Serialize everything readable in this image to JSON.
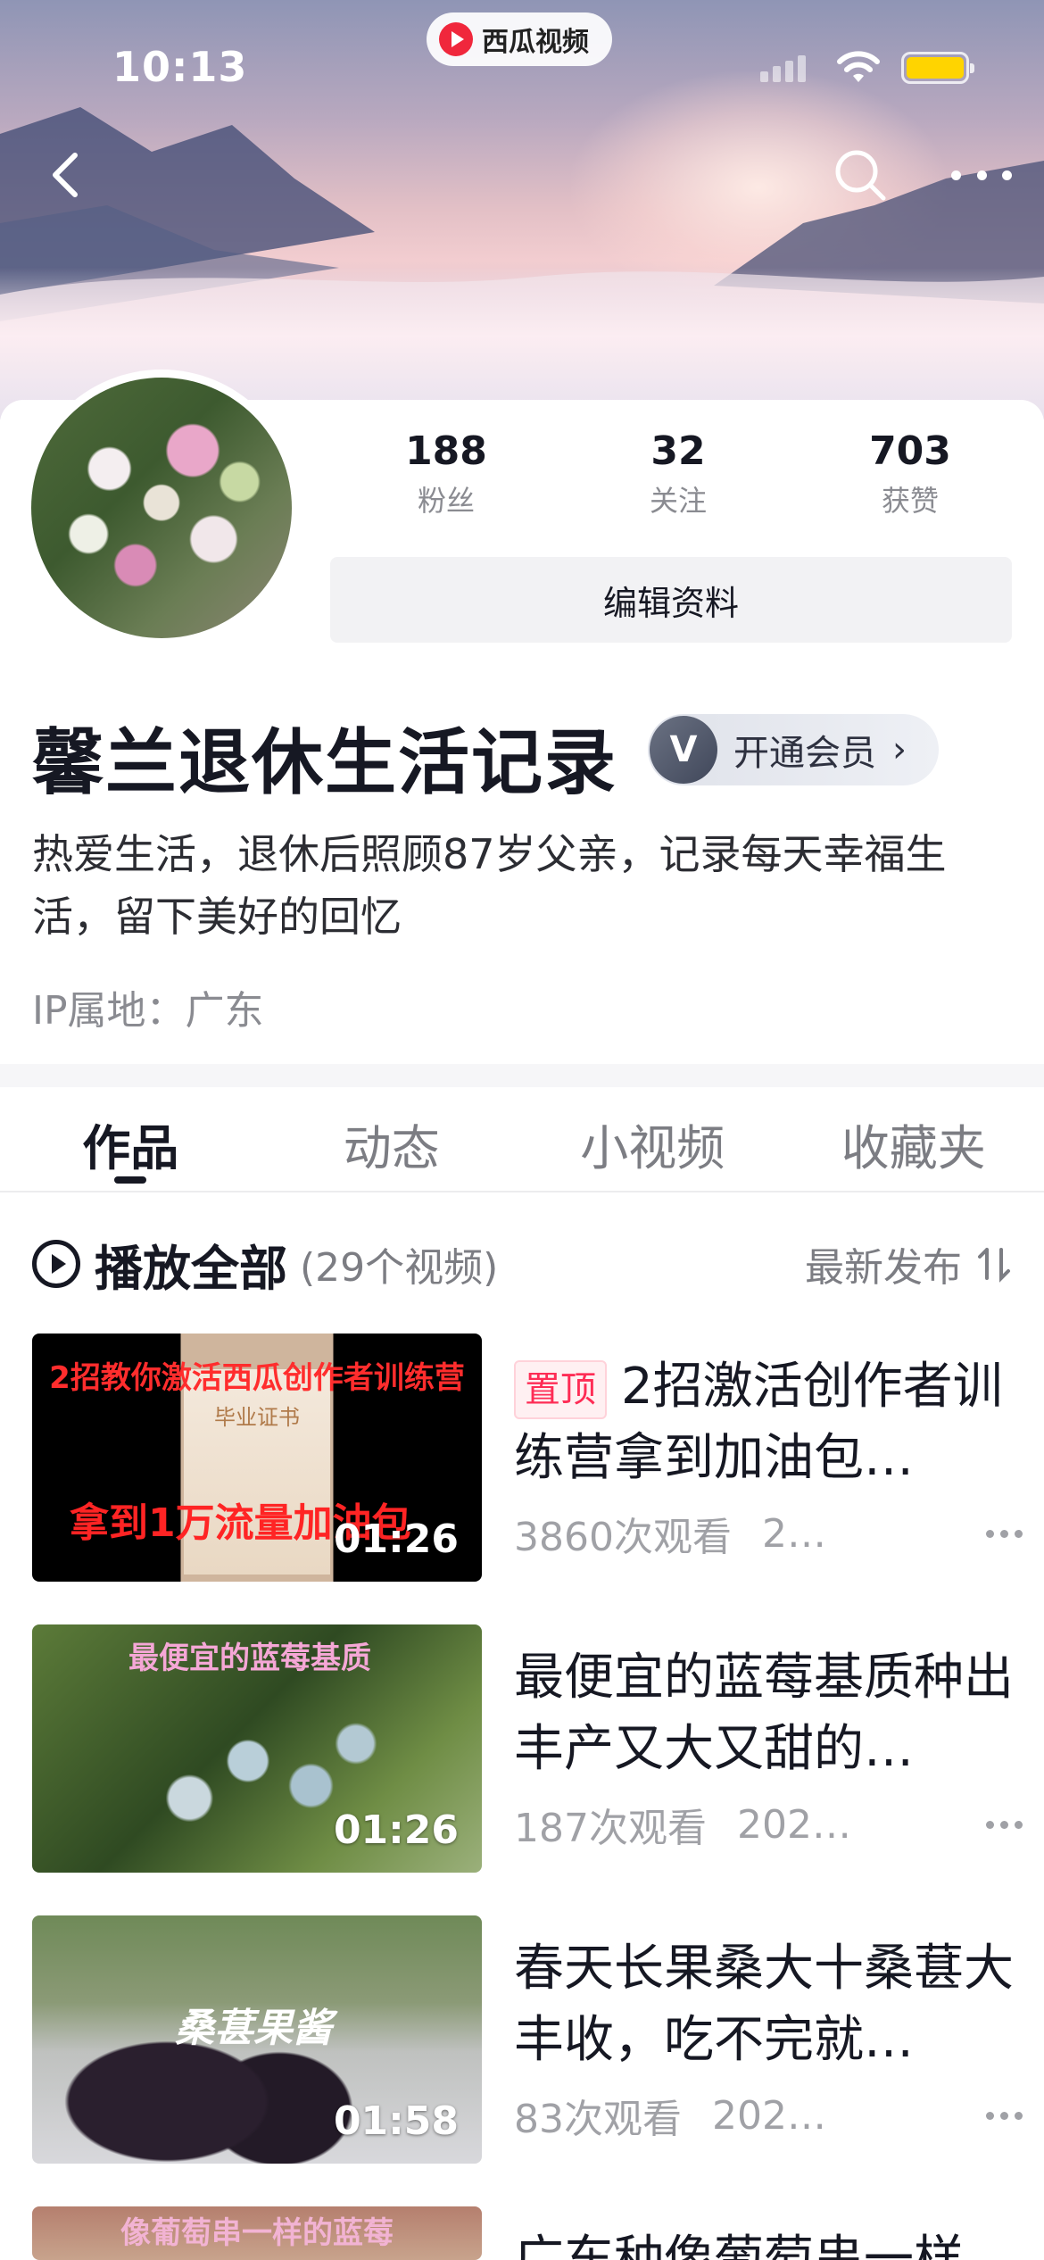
{
  "status_bar": {
    "time": "10:13",
    "app_name": "西瓜视频",
    "battery_color": "#ffd400"
  },
  "nav": {
    "back_icon": "chevron-left-icon",
    "search_icon": "search-icon",
    "more_icon": "more-dots-icon"
  },
  "stats": [
    {
      "value": "188",
      "label": "粉丝"
    },
    {
      "value": "32",
      "label": "关注"
    },
    {
      "value": "703",
      "label": "获赞"
    }
  ],
  "profile": {
    "edit_button": "编辑资料",
    "username": "馨兰退休生活记录",
    "vip_icon_text": "V",
    "vip_label": "开通会员",
    "bio": "热爱生活，退休后照顾87岁父亲，记录每天幸福生活，留下美好的回忆",
    "ip_location": "IP属地：广东"
  },
  "tabs": [
    {
      "label": "作品",
      "active": true
    },
    {
      "label": "动态",
      "active": false
    },
    {
      "label": "小视频",
      "active": false
    },
    {
      "label": "收藏夹",
      "active": false
    }
  ],
  "list_header": {
    "play_all": "播放全部",
    "count": "(29个视频)",
    "sort": "最新发布"
  },
  "videos": [
    {
      "pinned_label": "置顶",
      "title": "2招激活创作者训练营拿到加油包…",
      "views": "3860次观看",
      "date": "2…",
      "duration": "01:26",
      "thumb_caption_top": "2招教你激活西瓜创作者训练营",
      "thumb_caption_mid": "毕业证书",
      "thumb_caption_bottom": "拿到1万流量加油包"
    },
    {
      "title": "最便宜的蓝莓基质种出丰产又大又甜的…",
      "views": "187次观看",
      "date": "202…",
      "duration": "01:26",
      "thumb_caption_top": "最便宜的蓝莓基质"
    },
    {
      "title": "春天长果桑大十桑葚大丰收，吃不完就…",
      "views": "83次观看",
      "date": "202…",
      "duration": "01:58",
      "thumb_caption_top": "桑葚果酱"
    },
    {
      "title": "广东种像葡萄串一样…",
      "thumb_caption_top": "像葡萄串一样的蓝莓"
    }
  ],
  "colors": {
    "accent_red": "#fe2c55",
    "text_primary": "#161823",
    "text_secondary": "#8a8b91"
  }
}
